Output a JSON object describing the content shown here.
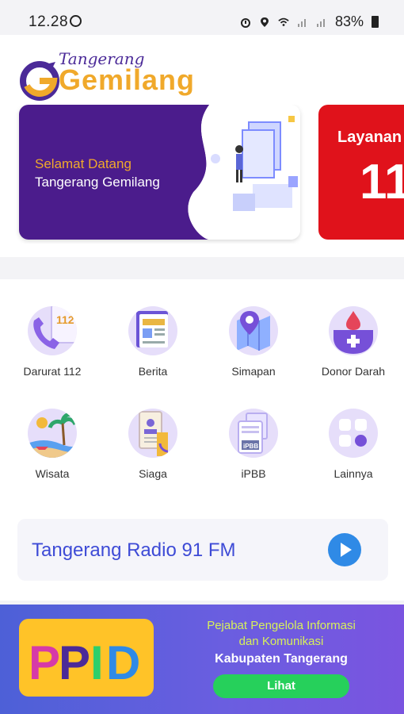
{
  "status_bar": {
    "time": "12.28",
    "battery": "83%"
  },
  "logo": {
    "script": "Tangerang",
    "main": "Gemilang"
  },
  "banners": [
    {
      "line1": "Selamat Datang",
      "line2": "Tangerang Gemilang"
    },
    {
      "line1": "Layanan",
      "line2": "11"
    }
  ],
  "menu": {
    "items": [
      {
        "label": "Darurat 112",
        "icon": "phone-112-icon"
      },
      {
        "label": "Berita",
        "icon": "news-icon"
      },
      {
        "label": "Simapan",
        "icon": "map-pin-icon"
      },
      {
        "label": "Donor Darah",
        "icon": "blood-drop-icon"
      },
      {
        "label": "Wisata",
        "icon": "beach-icon"
      },
      {
        "label": "Siaga",
        "icon": "phonebook-icon"
      },
      {
        "label": "iPBB",
        "icon": "tax-document-icon"
      },
      {
        "label": "Lainnya",
        "icon": "grid-more-icon"
      }
    ]
  },
  "radio": {
    "title": "Tangerang Radio 91 FM"
  },
  "ppid": {
    "badge": "PPID",
    "line1": "Pejabat Pengelola Informasi",
    "line2": "dan Komunikasi",
    "line3": "Kabupaten Tangerang",
    "button": "Lihat"
  },
  "colors": {
    "brand_purple": "#4b1c8c",
    "brand_orange": "#f0a92b",
    "accent_blue": "#3e4bd6",
    "emergency_red": "#e0121b",
    "lihat_green": "#26d05b"
  }
}
